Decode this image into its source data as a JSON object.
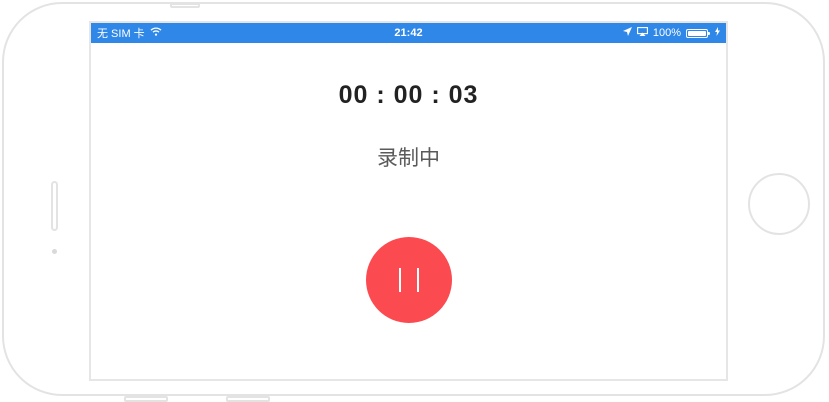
{
  "status_bar": {
    "carrier": "无 SIM 卡",
    "time": "21:42",
    "battery_percent": "100%",
    "background_color": "#2f87e8"
  },
  "recorder": {
    "elapsed_time": "00 : 00 : 03",
    "status_text": "录制中",
    "button_color": "#fc4a51"
  },
  "icons": {
    "wifi": "wifi-icon",
    "location": "location-arrow-icon",
    "airplay": "airplay-icon",
    "battery": "battery-icon",
    "charging": "charging-bolt-icon",
    "pause": "pause-icon"
  }
}
